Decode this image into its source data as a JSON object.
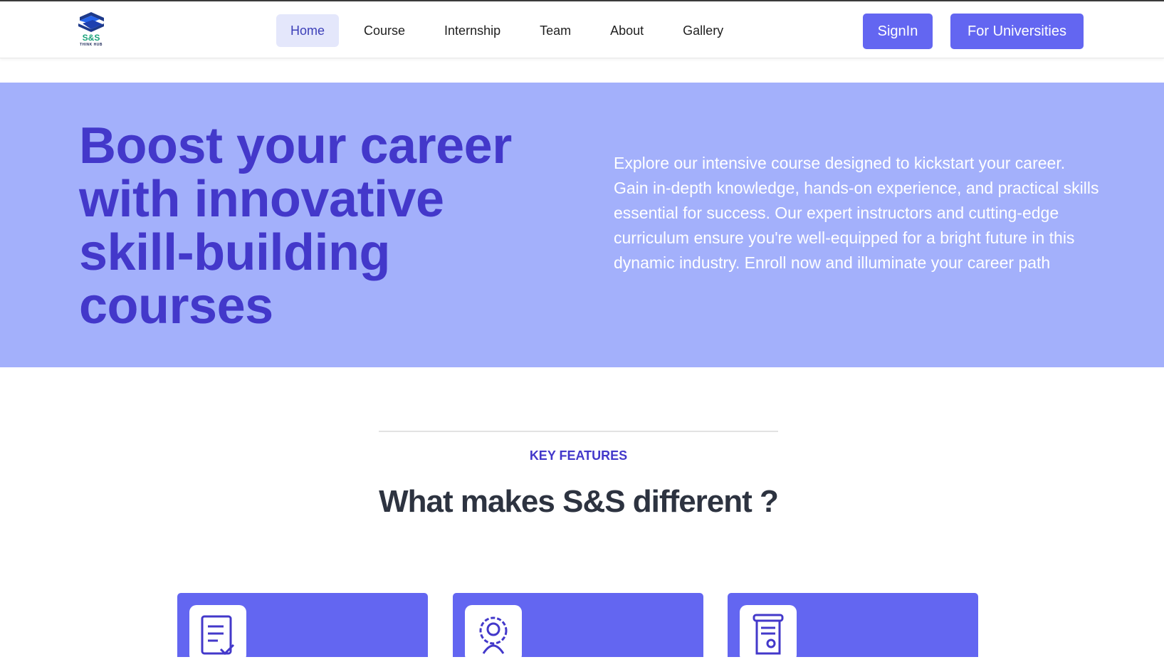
{
  "brand": {
    "logo_text": "S&S",
    "logo_subtext": "THINK HUB",
    "colors": {
      "primary": "#6366f1",
      "accent_text": "#4338ca",
      "hero_bg": "#a3b0fb",
      "logo_green": "#1aa37a"
    }
  },
  "nav": {
    "items": [
      {
        "label": "Home",
        "active": true
      },
      {
        "label": "Course",
        "active": false
      },
      {
        "label": "Internship",
        "active": false
      },
      {
        "label": "Team",
        "active": false
      },
      {
        "label": "About",
        "active": false
      },
      {
        "label": "Gallery",
        "active": false
      }
    ],
    "signin_label": "SignIn",
    "universities_label": "For Universities"
  },
  "hero": {
    "title_lines": [
      "Boost your career",
      "with innovative",
      "skill-building",
      "courses"
    ],
    "description": "Explore our intensive course designed to kickstart your career. Gain in-depth knowledge, hands-on experience, and practical skills essential for success. Our expert instructors and cutting-edge curriculum ensure you're well-equipped for a bright future in this dynamic industry. Enroll now and illuminate your career path"
  },
  "features": {
    "label": "KEY FEATURES",
    "title": "What makes S&S different ?",
    "cards": [
      {
        "icon": "document-check-icon"
      },
      {
        "icon": "gear-person-icon"
      },
      {
        "icon": "certificate-scroll-icon"
      }
    ]
  }
}
